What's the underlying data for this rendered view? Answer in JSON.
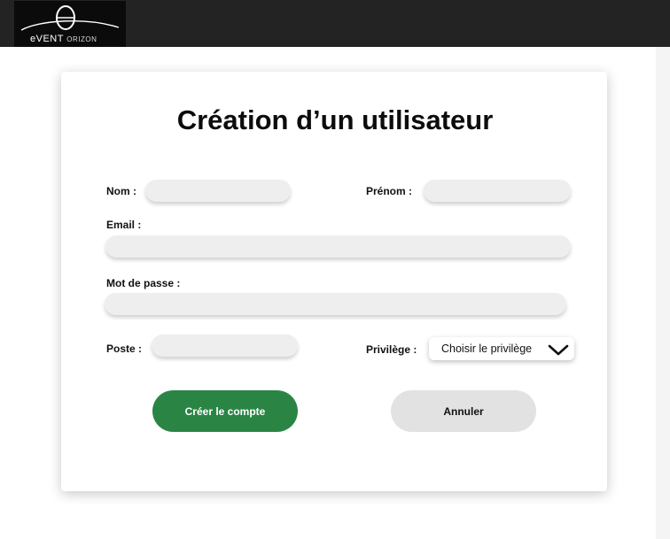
{
  "header": {
    "logo_text_main": "eVENT",
    "logo_text_sub": "ORIZON",
    "logo_icon": "event-horizon-logo-icon"
  },
  "form": {
    "title": "Création d’un utilisateur",
    "nom_label": "Nom :",
    "nom_value": "",
    "prenom_label": "Prénom :",
    "prenom_value": "",
    "email_label": "Email :",
    "email_value": "",
    "password_label": "Mot de passe :",
    "password_value": "",
    "poste_label": "Poste :",
    "poste_value": "",
    "privilege_label": "Privilège :",
    "privilege_selected": "Choisir le privilège",
    "privilege_icon": "chevron-down-icon"
  },
  "actions": {
    "create_label": "Créer le compte",
    "cancel_label": "Annuler"
  },
  "colors": {
    "topbar": "#232323",
    "primary_button": "#2a8545",
    "secondary_button": "#e2e2e2",
    "field_background": "#eeeeee"
  }
}
